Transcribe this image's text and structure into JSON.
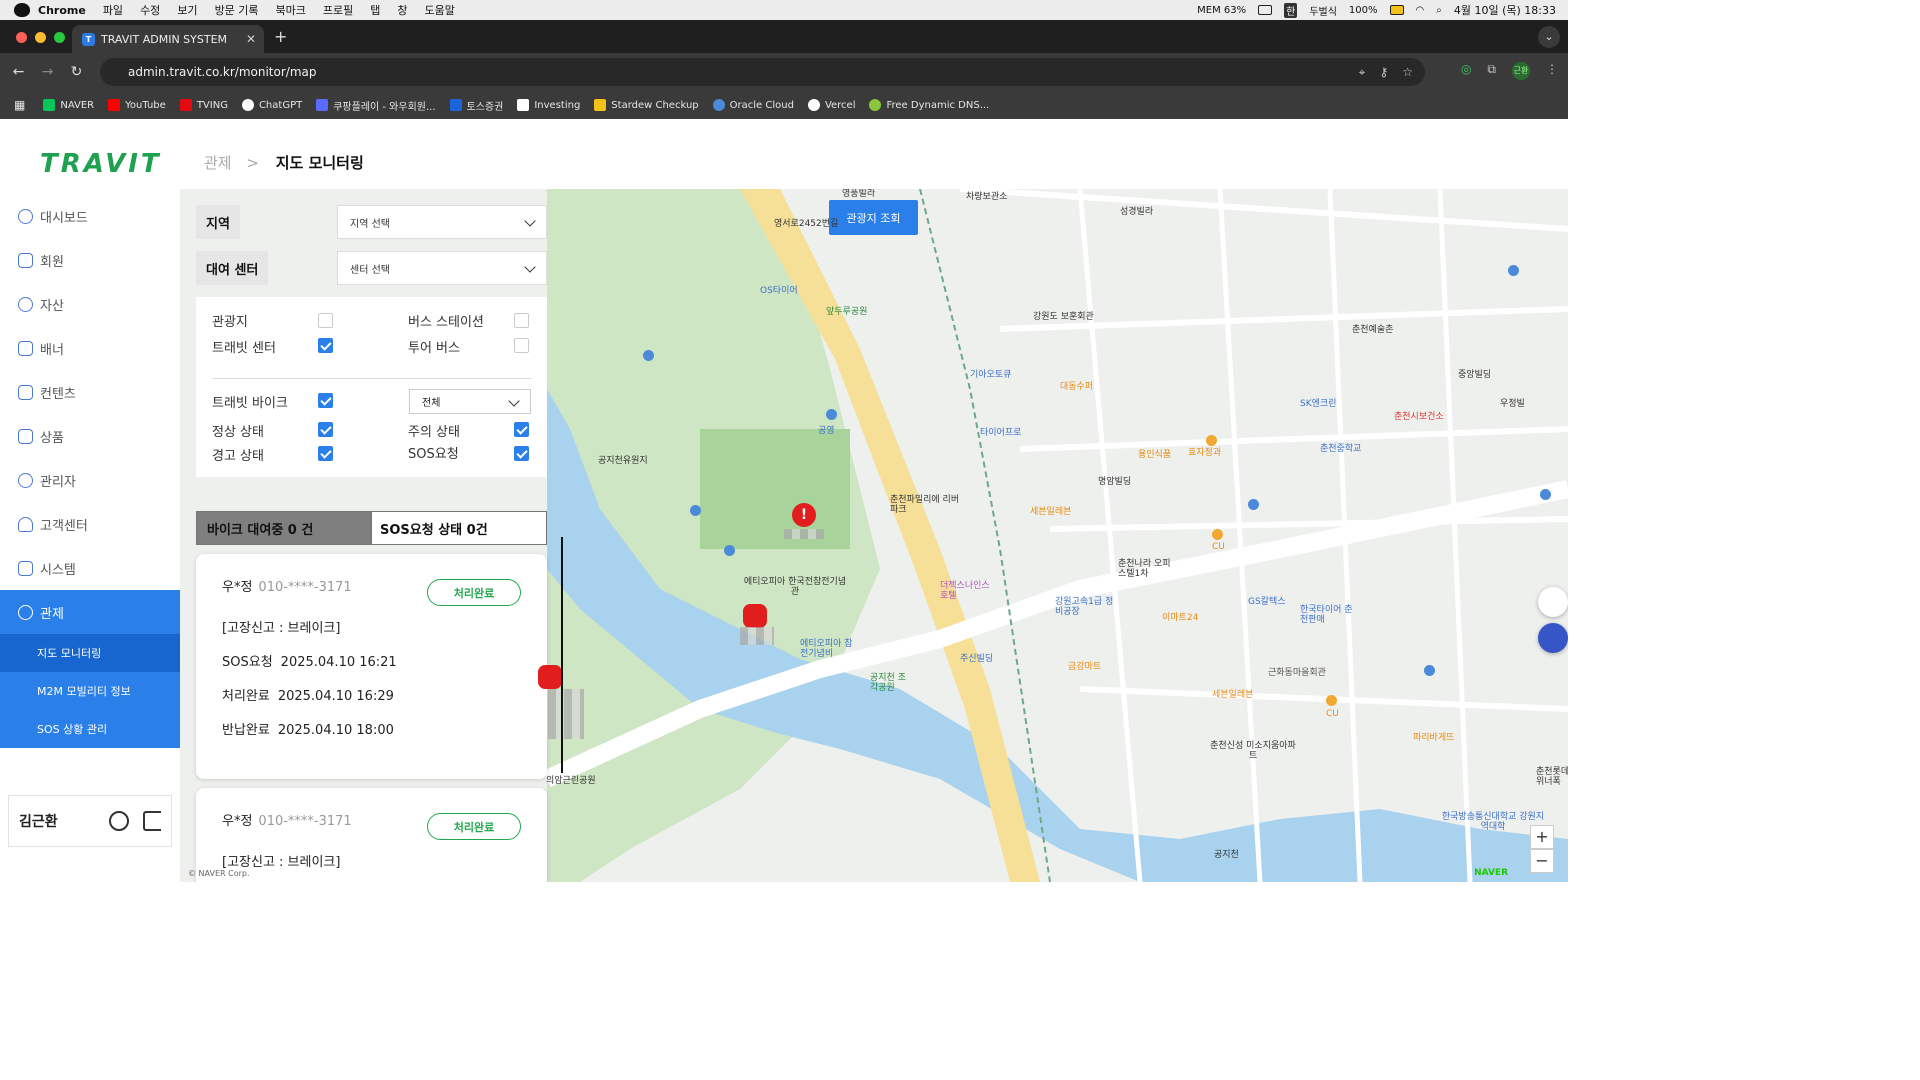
{
  "macos": {
    "app": "Chrome",
    "menus": [
      "파일",
      "수정",
      "보기",
      "방문 기록",
      "북마크",
      "프로필",
      "탭",
      "창",
      "도움말"
    ],
    "status": {
      "mem": "MEM 63%",
      "ime": "한",
      "ime_label": "두벌식",
      "battery": "100%",
      "datetime": "4월 10일 (목) 18:33"
    }
  },
  "browser": {
    "tab_title": "TRAVIT ADMIN SYSTEM",
    "tab_favicon": "T",
    "url": "admin.travit.co.kr/monitor/map",
    "profile": "근환",
    "bookmarks": [
      "NAVER",
      "YouTube",
      "TVING",
      "ChatGPT",
      "쿠팡플레이 - 와우회원...",
      "토스증권",
      "Investing",
      "Stardew Checkup",
      "Oracle Cloud",
      "Vercel",
      "Free Dynamic DNS..."
    ],
    "bookmark_colors": [
      "#03c75a",
      "#ff0000",
      "#e50914",
      "#ffffff",
      "#5b6bff",
      "#1b64da",
      "#ffffff",
      "#f2c21b",
      "#4a8ad8",
      "#ffffff",
      "#8cc63f"
    ]
  },
  "sidebar": {
    "logo": "TRAVIT",
    "items": [
      "대시보드",
      "회원",
      "자산",
      "배너",
      "컨텐츠",
      "상품",
      "관리자",
      "고객센터",
      "시스템",
      "관제"
    ],
    "sub_items": [
      "지도 모니터링",
      "M2M 모빌리티 정보",
      "SOS 상황 관리"
    ],
    "user_name": "김근환"
  },
  "header": {
    "breadcrumb_parent": "관제",
    "breadcrumb_sep": ">",
    "page_title": "지도 모니터링"
  },
  "filters": {
    "region_label": "지역",
    "region_placeholder": "지역 선택",
    "center_label": "대여 센터",
    "center_placeholder": "센터 선택",
    "checkboxes": [
      {
        "label": "관광지",
        "checked": false
      },
      {
        "label": "버스 스테이션",
        "checked": false
      },
      {
        "label": "트래빗 센터",
        "checked": true
      },
      {
        "label": "투어 버스",
        "checked": false
      },
      {
        "label": "트래빗 바이크",
        "checked": true
      },
      {
        "label": "정상 상태",
        "checked": true
      },
      {
        "label": "주의 상태",
        "checked": true
      },
      {
        "label": "경고 상태",
        "checked": true
      },
      {
        "label": "SOS요청",
        "checked": true
      }
    ],
    "bike_filter": "전체"
  },
  "summary": {
    "renting": "바이크 대여중 0 건",
    "sos": "SOS요청 상태 0건"
  },
  "cards": [
    {
      "name": "우*정",
      "phone": "010-****-3171",
      "status": "처리완료",
      "report": "[고장신고 : 브레이크]",
      "sos_label": "SOS요청",
      "sos_time": "2025.04.10 16:21",
      "done_label": "처리완료",
      "done_time": "2025.04.10 16:29",
      "return_label": "반납완료",
      "return_time": "2025.04.10 18:00"
    },
    {
      "name": "우*정",
      "phone": "010-****-3171",
      "status": "처리완료",
      "report": "[고장신고 : 브레이크]"
    }
  ],
  "map": {
    "search_button": "관광지 조회",
    "copyright": "© NAVER Corp.",
    "brand": "NAVER",
    "labels": [
      "영풍빌라",
      "차량보관소",
      "성경빌라",
      "영서로2452번길",
      "OS타이어",
      "앞두루공원",
      "강원도 보훈회관",
      "기아오토큐",
      "대동수퍼",
      "공영",
      "타이어프로",
      "SK엔크린",
      "춘천시보건소",
      "춘천예술촌",
      "중앙빌딩",
      "우정빌",
      "춘천중학교",
      "용인식품",
      "효자정과",
      "명암빌딩",
      "공지천유원지",
      "춘천파밀리에 리버파크",
      "세븐일레븐",
      "CU",
      "에티오피아 한국전참전기념관",
      "춘천나라 오피스텔1차",
      "더젝스나인스 호텔",
      "강원고속1급 정비공장",
      "이마트24",
      "GS칼텍스",
      "한국타이어 춘천판매",
      "에티오피아 참전기념비",
      "공지천 조각공원",
      "주신빌딩",
      "금강마트",
      "근화동마을회관",
      "세븐일레븐",
      "CU",
      "춘천신성 미소지움아파트",
      "파리바게뜨",
      "한국방송통신대학교 강원지역대학",
      "공지천",
      "춘천롯데 위너폭",
      "의암근린공원"
    ]
  },
  "colors": {
    "primary": "#2b7fe8",
    "active_sub": "#1766cf",
    "brand_green": "#1fa24f",
    "done_green": "#21a84e",
    "sos_red": "#e21d1d",
    "water": "#a9d2ee",
    "park": "#cfe6c5",
    "road": "#f6df96"
  }
}
